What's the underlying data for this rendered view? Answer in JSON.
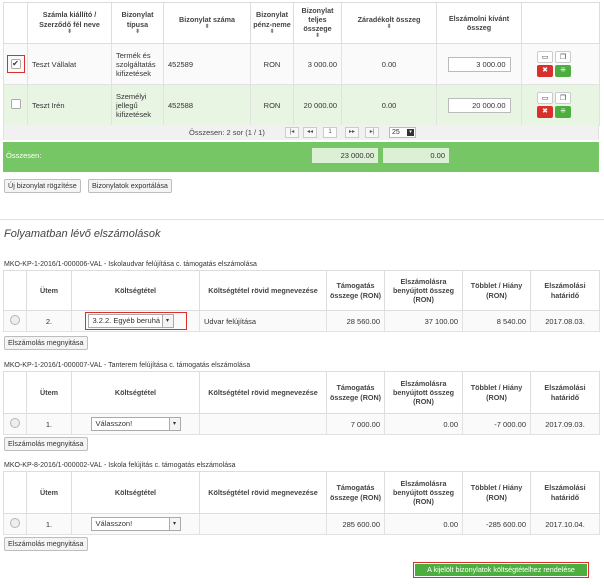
{
  "invoice_table": {
    "headers": {
      "issuer": "Számla kiállító / Szerződő fél neve",
      "type": "Bizonylat típusa",
      "number": "Bizonylat száma",
      "currency": "Bizonylat pénz-neme",
      "total": "Bizonylat teljes összege",
      "withheld": "Záradékolt összeg",
      "to_settle": "Elszámolni kívánt összeg",
      "sort_glyph": "⬍"
    },
    "rows": [
      {
        "checked": true,
        "issuer": "Teszt Vállalat",
        "type": "Termék és szolgáltatás kifizetések",
        "number": "452589",
        "currency": "RON",
        "total": "3 000.00",
        "withheld": "0.00",
        "to_settle": "3 000.00"
      },
      {
        "checked": false,
        "issuer": "Teszt Irén",
        "type": "Személyi jellegű kifizetések",
        "number": "452588",
        "currency": "RON",
        "total": "20 000.00",
        "withheld": "0.00",
        "to_settle": "20 000.00"
      }
    ],
    "pager": {
      "summary": "Összesen: 2 sor (1 / 1)",
      "page": "1",
      "page_size": "25"
    },
    "totals": {
      "label": "Összesen:",
      "total": "23 000.00",
      "withheld": "0.00"
    }
  },
  "actions": {
    "new_invoice": "Új bizonylat rögzítése",
    "export": "Bizonylatok exportálása"
  },
  "section_heading": "Folyamatban lévő elszámolások",
  "settlement_headers": {
    "stage": "Ütem",
    "cost_item": "Költségtétel",
    "short_name": "Költségtétel rövid megnevezése",
    "support": "Támogatás összege (RON)",
    "submitted": "Elszámolásra benyújtott összeg (RON)",
    "diff": "Többlet / Hiány (RON)",
    "deadline": "Elszámolási határidő"
  },
  "settlements": [
    {
      "title": "MKO-KP-1-2016/1-000006-VAL - Iskolaudvar felújítása c. támogatás elszámolása",
      "stage": "2.",
      "cost_item": "3.2.2. Egyéb beruhá",
      "short_name": "Udvar felújítása",
      "support": "28 560.00",
      "submitted": "37 100.00",
      "diff": "8 540.00",
      "deadline": "2017.08.03.",
      "button": "Elszámolás megnyitása"
    },
    {
      "title": "MKO-KP-1-2016/1-000007-VAL - Tanterem felújítása c. támogatás elszámolása",
      "stage": "1.",
      "cost_item": "Válasszon!",
      "short_name": "",
      "support": "7 000.00",
      "submitted": "0.00",
      "diff": "-7 000.00",
      "deadline": "2017.09.03.",
      "button": "Elszámolás megnyitása"
    },
    {
      "title": "MKO-KP-8-2016/1-000002-VAL - Iskola felújítás c. támogatás elszámolása",
      "stage": "1.",
      "cost_item": "Válasszon!",
      "short_name": "",
      "support": "285 600.00",
      "submitted": "0.00",
      "diff": "-285 600.00",
      "deadline": "2017.10.04.",
      "button": "Elszámolás megnyitása"
    }
  ],
  "assign_button": "A kijelölt bizonylatok költségtételhez rendelése",
  "icons": {
    "folder": "folder-open-icon",
    "copy": "copy-icon",
    "delete": "trash-icon",
    "split": "split-icon"
  },
  "colors": {
    "total_bar": "#77c666",
    "selected_row": "#e9f5e3",
    "highlight": "#d9302b",
    "primary_green": "#4cae3f"
  }
}
